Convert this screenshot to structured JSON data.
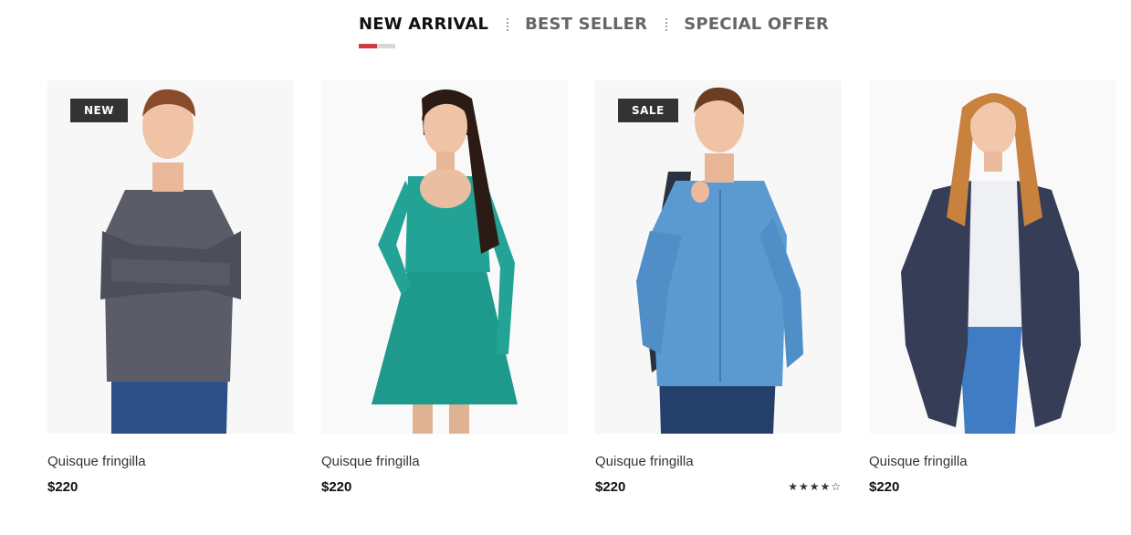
{
  "tabs": {
    "items": [
      {
        "label": "NEW ARRIVAL",
        "active": true
      },
      {
        "label": "BEST SELLER",
        "active": false
      },
      {
        "label": "SPECIAL OFFER",
        "active": false
      }
    ],
    "underline_colors": [
      "#d33b3b",
      "#d7d7d7"
    ]
  },
  "products": [
    {
      "badge": "NEW",
      "name": "Quisque fringilla",
      "price": "$220",
      "image": "man-grey-sweater-jeans",
      "rating": null
    },
    {
      "badge": "",
      "name": "Quisque fringilla",
      "price": "$220",
      "image": "woman-teal-lace-dress",
      "rating": null
    },
    {
      "badge": "SALE",
      "name": "Quisque fringilla",
      "price": "$220",
      "image": "man-blue-shirt-jacket",
      "rating": {
        "value": 4,
        "max": 5,
        "display": "★★★★☆"
      }
    },
    {
      "badge": "",
      "name": "Quisque fringilla",
      "price": "$220",
      "image": "woman-navy-cardigan",
      "rating": null
    }
  ],
  "colors": {
    "badge_bg": "#333333",
    "image_bg": "#f7f7f7",
    "active_tab": "#111111",
    "inactive_tab": "#666666"
  }
}
